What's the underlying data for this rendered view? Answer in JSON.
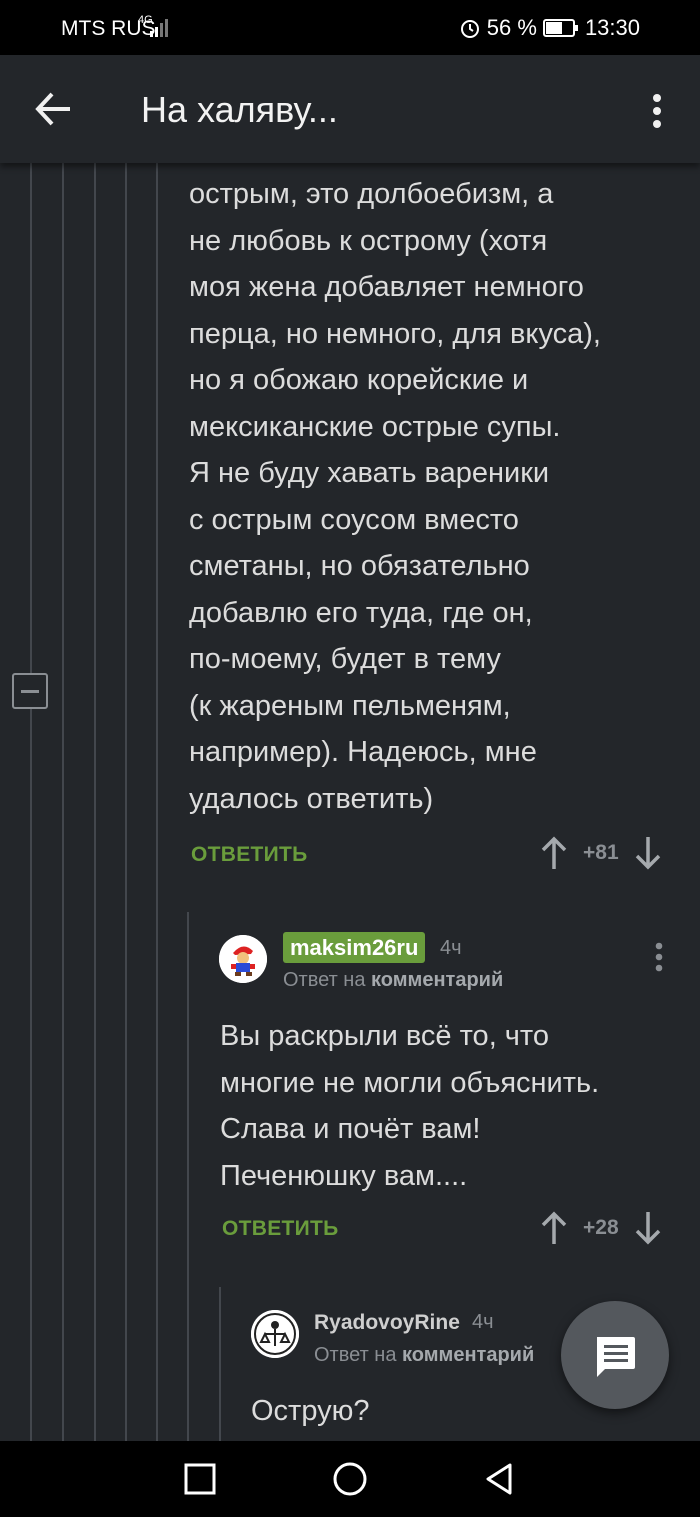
{
  "status_bar": {
    "carrier": "MTS RUS",
    "network": "4G",
    "battery_percent": "56 %",
    "time": "13:30"
  },
  "app_bar": {
    "title": "На халяву..."
  },
  "comment_1": {
    "lines": [
      "острым, это долбоебизм, а",
      "не любовь к острому (хотя",
      "моя жена добавляет немного",
      "перца, но немного, для вкуса),",
      "но я обожаю корейские и",
      "мексиканские острые супы.",
      "Я не буду хавать вареники",
      "с острым соусом вместо",
      "сметаны, но обязательно",
      "добавлю его туда, где он,",
      "по-моему, будет в тему",
      "(к жареным пельменям,",
      "например). Надеюсь, мне",
      "удалось ответить)"
    ],
    "reply_label": "ОТВЕТИТЬ",
    "rating": "+81"
  },
  "comment_2": {
    "username": "maksim26ru",
    "time": "4ч",
    "reply_prefix": "Ответ на",
    "reply_target": "комментарий",
    "text_lines": [
      "Вы раскрыли всё то, что",
      "многие не могли объяснить.",
      "Слава и почёт вам!",
      "Печенюшку вам...."
    ],
    "reply_label": "ОТВЕТИТЬ",
    "rating": "+28"
  },
  "comment_3": {
    "username": "RyadovoyRine",
    "time": "4ч",
    "reply_prefix": "Ответ на",
    "reply_target": "комментарий",
    "text": "Острую?"
  },
  "icons": {
    "back": "arrow-left-icon",
    "more": "more-vertical-icon",
    "collapse": "minus-square-icon",
    "upvote": "arrow-up-icon",
    "downvote": "arrow-down-icon",
    "fab": "comment-icon"
  },
  "colors": {
    "background": "#23262a",
    "accent_green": "#6a9d3c"
  }
}
